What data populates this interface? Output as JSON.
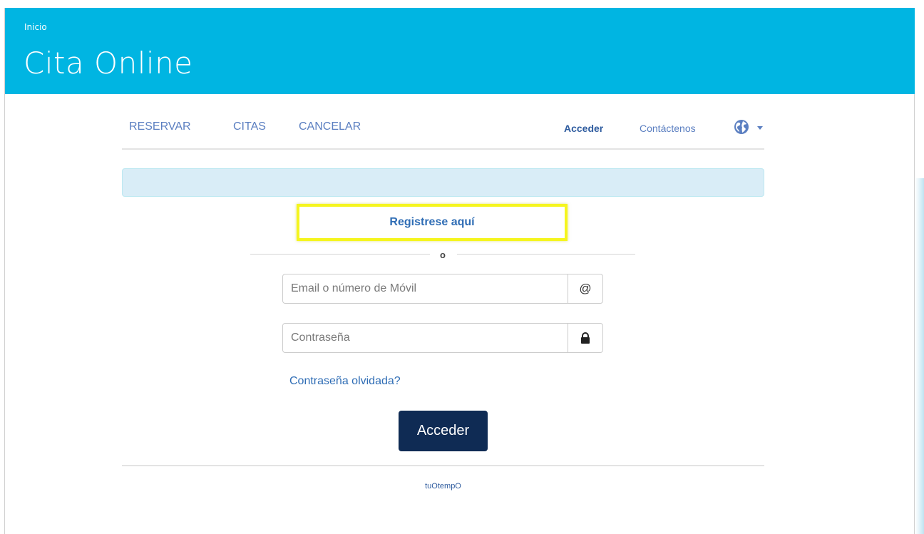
{
  "header": {
    "breadcrumb": "Inicio",
    "title": "Cita Online",
    "background_color": "#00b5e2"
  },
  "nav": {
    "items": [
      {
        "label": "RESERVAR"
      },
      {
        "label": "CITAS"
      },
      {
        "label": "CANCELAR"
      }
    ],
    "login_label": "Acceder",
    "contact_label": "Contáctenos",
    "language_icon": "globe-icon"
  },
  "register": {
    "link_label": "Registrese aquí",
    "highlight_color": "#f5f51e"
  },
  "divider": {
    "text": "o"
  },
  "login_form": {
    "email_placeholder": "Email o número de Móvil",
    "email_value": "",
    "email_addon": "@",
    "password_placeholder": "Contraseña",
    "password_value": "",
    "password_icon": "lock-icon",
    "forgot_label": "Contraseña olvidada?",
    "submit_label": "Acceder",
    "submit_color": "#0f2b54"
  },
  "footer": {
    "brand": "tuOtempO"
  }
}
